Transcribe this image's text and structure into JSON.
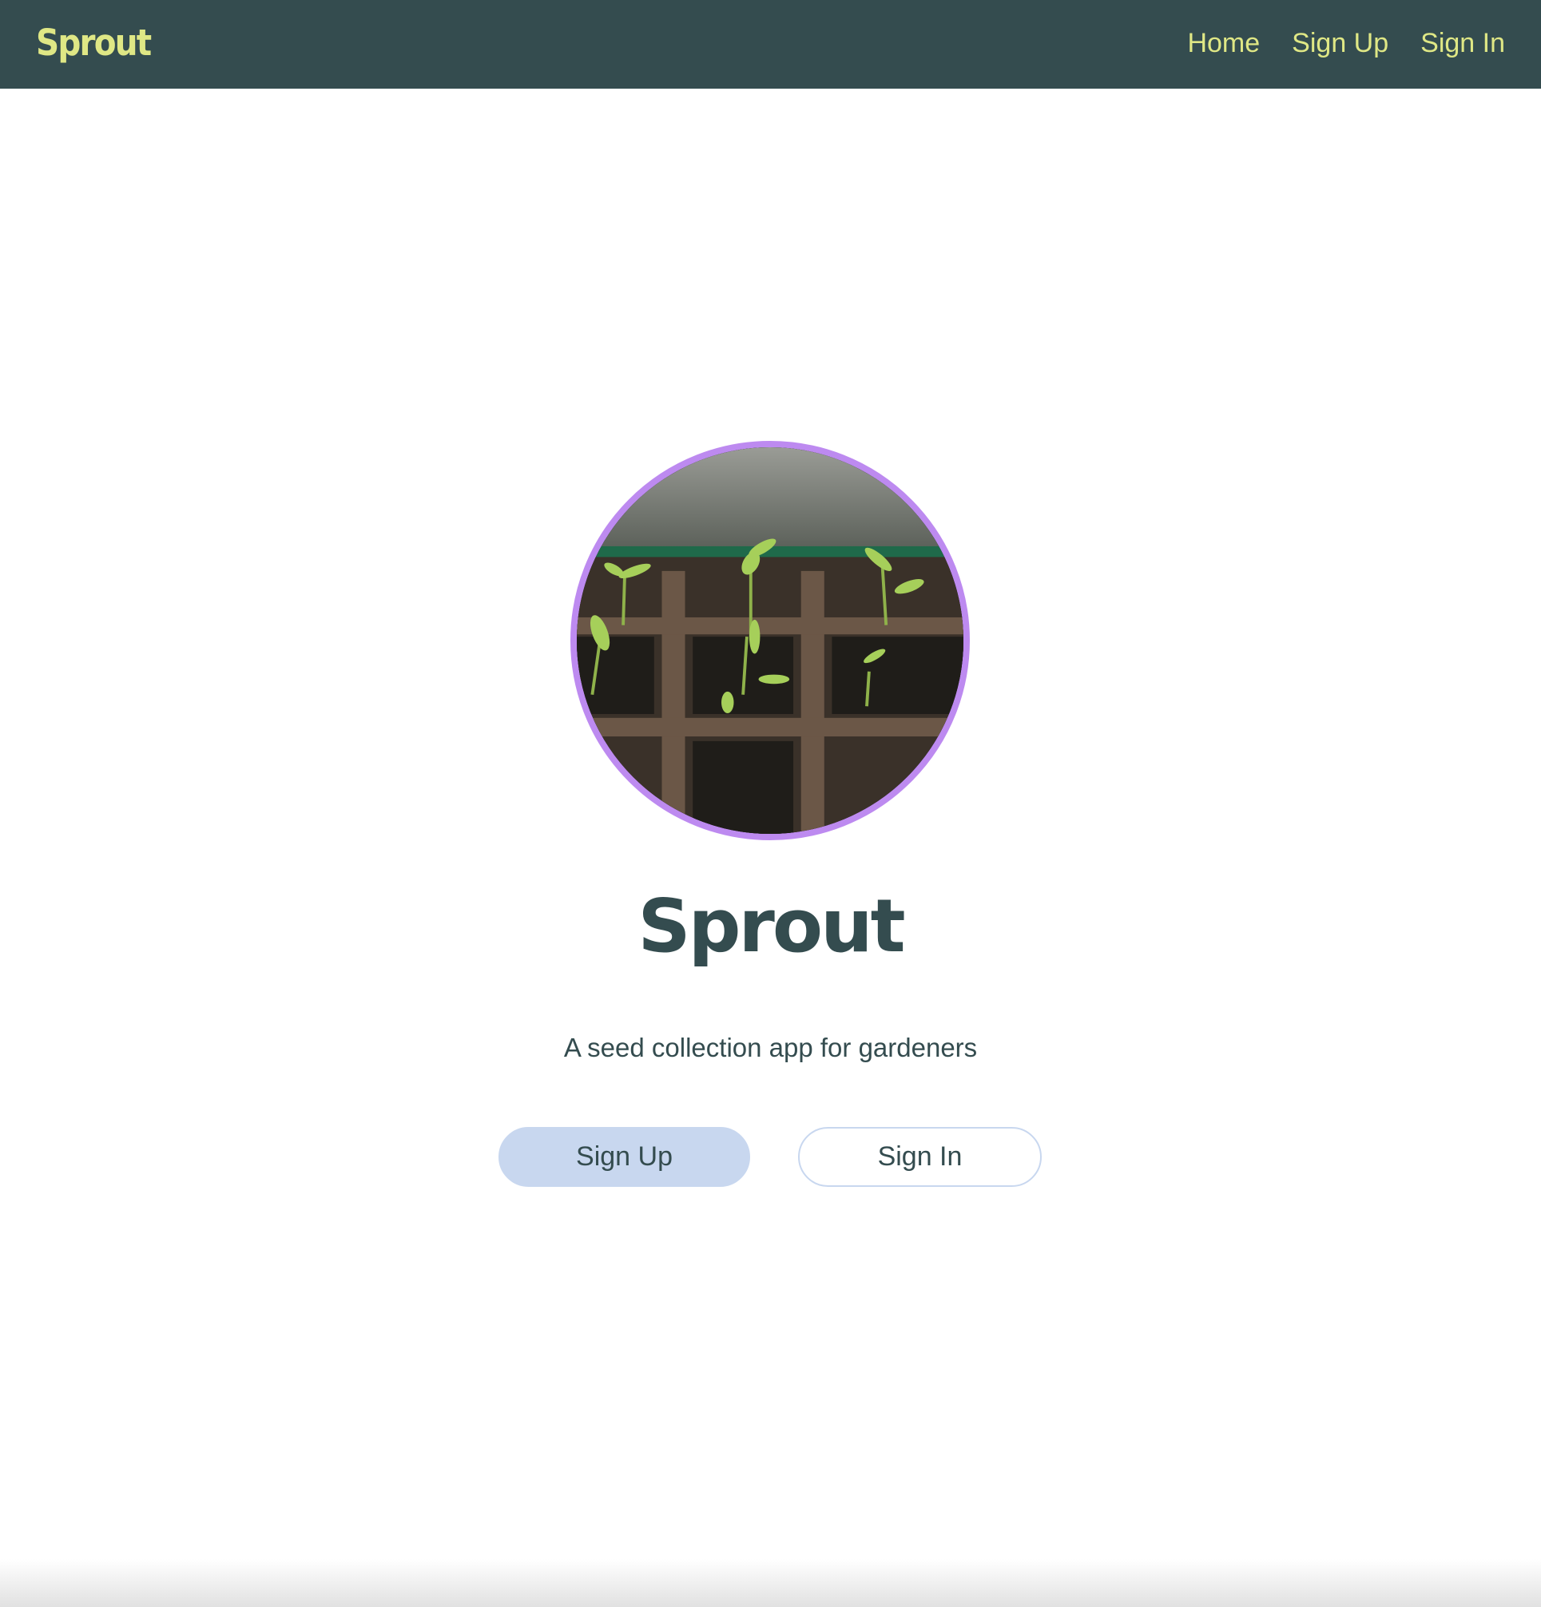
{
  "navbar": {
    "brand": "Sprout",
    "links": [
      {
        "label": "Home"
      },
      {
        "label": "Sign Up"
      },
      {
        "label": "Sign In"
      }
    ]
  },
  "hero": {
    "image_description_icon": "seedling-photo",
    "title": "Sprout",
    "tagline": "A seed collection app for gardeners",
    "primary_button": "Sign Up",
    "secondary_button": "Sign In"
  },
  "colors": {
    "navbar_bg": "#344c4f",
    "accent_yellow": "#dfe785",
    "image_border": "#bd8af0",
    "button_blue": "#c8d7ef",
    "text_dark": "#344c4f"
  }
}
